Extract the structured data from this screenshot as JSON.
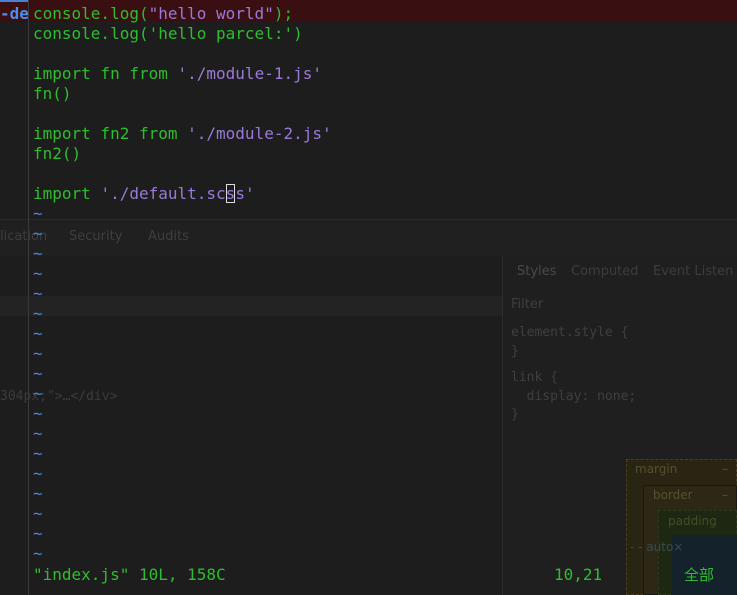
{
  "editor": {
    "tab_indicator": "-de",
    "lines": [
      {
        "parts": [
          {
            "t": "console.log(",
            "c": "tok-fn"
          },
          {
            "t": "\"hello world\"",
            "c": "tok-str"
          },
          {
            "t": ");",
            "c": "tok-paren"
          }
        ]
      },
      {
        "parts": [
          {
            "t": "console.log(",
            "c": "tok-fn"
          },
          {
            "t": "'hello parcel:'",
            "c": "tok-paren"
          },
          {
            "t": ")",
            "c": "tok-paren"
          }
        ]
      },
      {
        "parts": []
      },
      {
        "parts": [
          {
            "t": "import fn from ",
            "c": "tok-kw"
          },
          {
            "t": "'./module-1.js'",
            "c": "tok-str"
          }
        ]
      },
      {
        "parts": [
          {
            "t": "fn()",
            "c": "tok-fn"
          }
        ]
      },
      {
        "parts": []
      },
      {
        "parts": [
          {
            "t": "import fn2 from ",
            "c": "tok-kw"
          },
          {
            "t": "'./module-2.js'",
            "c": "tok-str"
          }
        ]
      },
      {
        "parts": [
          {
            "t": "fn2()",
            "c": "tok-fn"
          }
        ]
      },
      {
        "parts": []
      },
      {
        "parts": [
          {
            "t": "import ",
            "c": "tok-kw"
          },
          {
            "t": "'./default.sc",
            "c": "tok-str"
          },
          {
            "t": "s",
            "c": "tok-str cursor-box"
          },
          {
            "t": "s'",
            "c": "tok-str"
          }
        ]
      }
    ],
    "tilde_char": "~",
    "tilde_count": 18,
    "status": {
      "file_info": "\"index.js\" 10L, 158C",
      "cursor_pos": "10,21",
      "scroll": "全部"
    },
    "colors": {
      "syntax_green": "#2fbd2f",
      "string_purple": "#9a7ad8",
      "tilde_blue": "#4d86d6",
      "top_line_bg": "#3a0f12"
    }
  },
  "background_devtools": {
    "tabs": [
      "lication",
      "Security",
      "Audits"
    ],
    "pane_tabs": [
      "Styles",
      "Computed",
      "Event Listen"
    ],
    "filter_placeholder": "Filter",
    "element_style": "element.style {",
    "element_style_close": "}",
    "rule_selector": "link {",
    "rule_decl": "  display: none;",
    "rule_close": "}",
    "breadcrumb": "304px;\">…</div>",
    "box_model": {
      "margin_label": "margin",
      "border_label": "border",
      "padding_label": "padding",
      "dash": "–",
      "content_label": "- - auto×"
    }
  }
}
